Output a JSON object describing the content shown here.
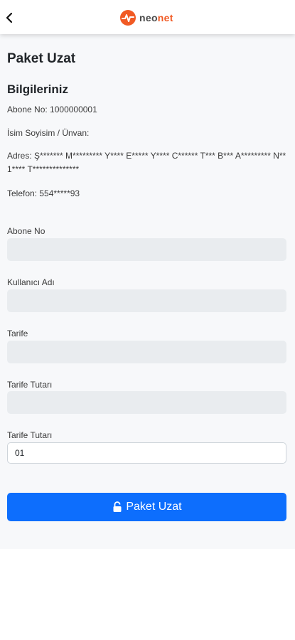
{
  "header": {
    "logo_text_1": "neo",
    "logo_text_2": "net",
    "brand_color": "#f15a24"
  },
  "page": {
    "title": "Paket Uzat",
    "section_title": "Bilgileriniz"
  },
  "info": {
    "abone_no": "Abone No: 1000000001",
    "isim": "İsim Soyisim / Ünvan:",
    "adres": "Adres: Ş******* M********* Y**** E***** Y**** C****** T*** B*** A********* N** 1**** T**************",
    "telefon": "Telefon: 554*****93"
  },
  "form": {
    "abone_no_label": "Abone No",
    "abone_no_value": "",
    "kullanici_adi_label": "Kullanıcı Adı",
    "kullanici_adi_value": "",
    "tarife_label": "Tarife",
    "tarife_value": "",
    "tarife_tutari_label": "Tarife Tutarı",
    "tarife_tutari_value": "",
    "tarife_tutari2_label": "Tarife Tutarı",
    "tarife_tutari2_value": "01"
  },
  "button": {
    "label": "Paket Uzat",
    "color": "#0d6efd"
  }
}
